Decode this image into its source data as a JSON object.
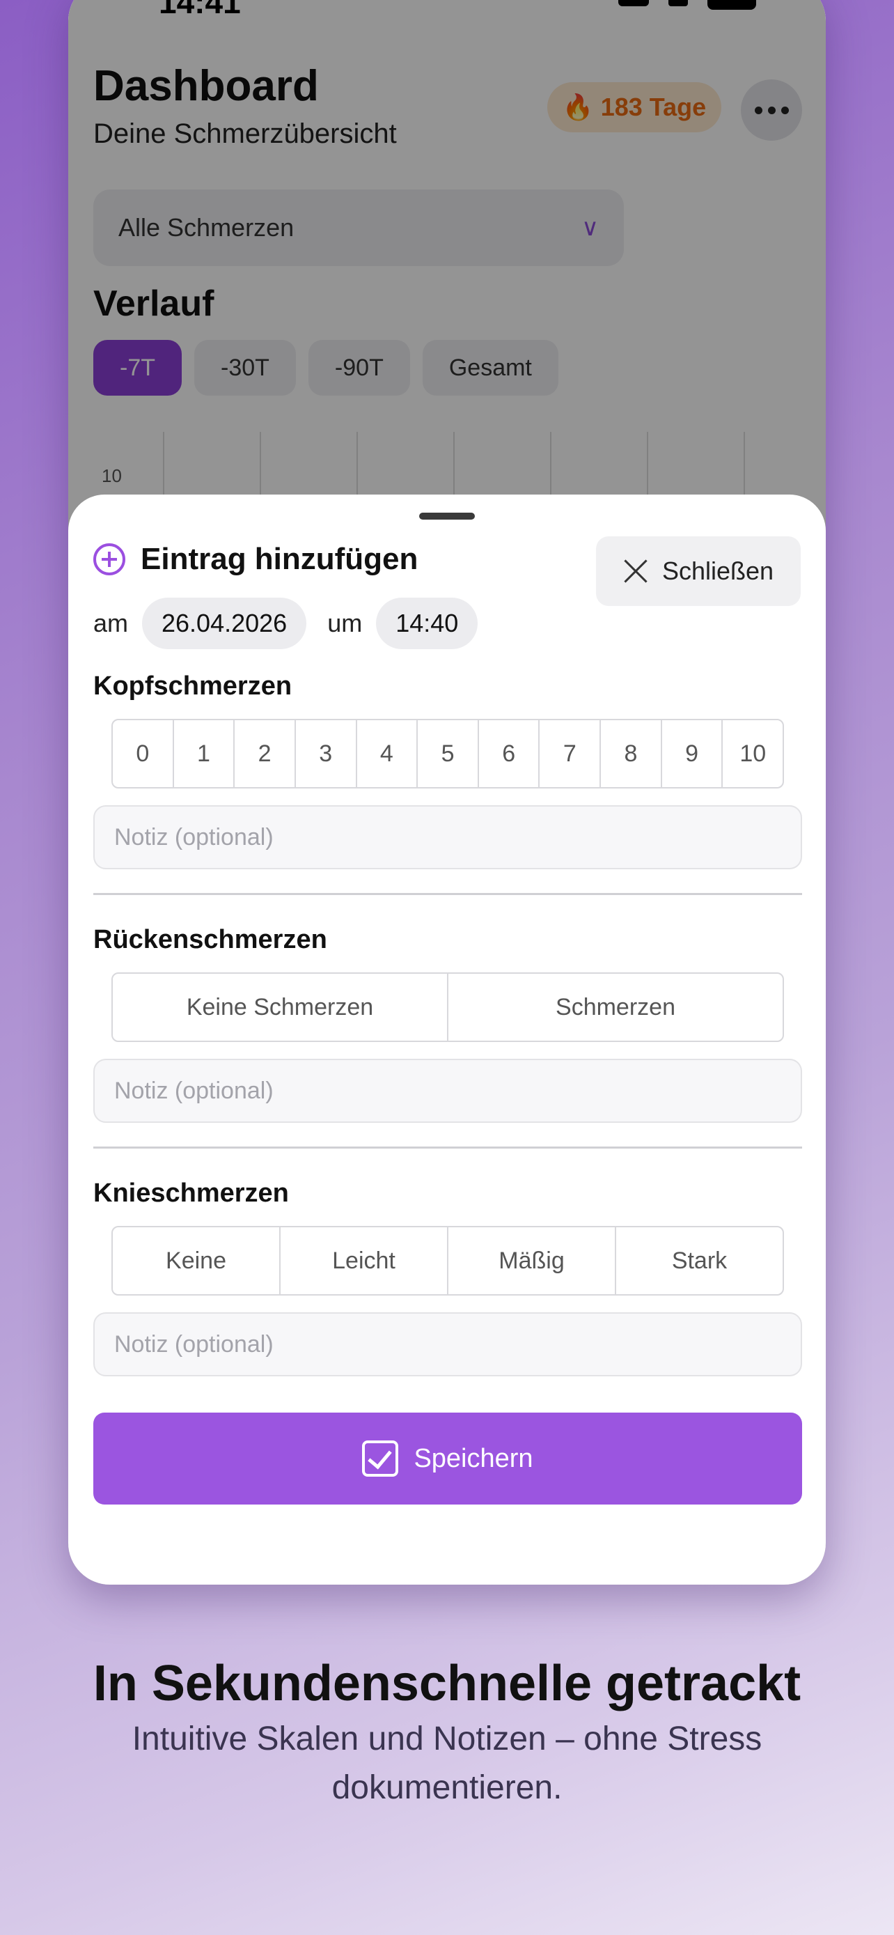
{
  "status_bar": {
    "time": "14:41"
  },
  "dashboard": {
    "title": "Dashboard",
    "subtitle": "Deine Schmerzübersicht",
    "streak_label": "183 Tage",
    "filter_value": "Alle Schmerzen",
    "section_title": "Verlauf",
    "ranges": [
      "-7T",
      "-30T",
      "-90T",
      "Gesamt"
    ],
    "active_range": "-7T",
    "chart_y_tick": "10"
  },
  "sheet": {
    "title": "Eintrag hinzufügen",
    "close_label": "Schließen",
    "date_prefix": "am",
    "date_value": "26.04.2026",
    "time_prefix": "um",
    "time_value": "14:40",
    "sections": [
      {
        "title": "Kopfschmerzen",
        "options": [
          "0",
          "1",
          "2",
          "3",
          "4",
          "5",
          "6",
          "7",
          "8",
          "9",
          "10"
        ],
        "note_placeholder": "Notiz (optional)"
      },
      {
        "title": "Rückenschmerzen",
        "options": [
          "Keine Schmerzen",
          "Schmerzen"
        ],
        "note_placeholder": "Notiz (optional)"
      },
      {
        "title": "Knieschmerzen",
        "options": [
          "Keine",
          "Leicht",
          "Mäßig",
          "Stark"
        ],
        "note_placeholder": "Notiz (optional)"
      }
    ],
    "save_label": "Speichern"
  },
  "marketing": {
    "headline": "In Sekundenschnelle getrackt",
    "subline": "Intuitive Skalen und Notizen – ohne Stress dokumentieren."
  },
  "colors": {
    "accent": "#9b55e0",
    "streak": "#e86a12"
  }
}
